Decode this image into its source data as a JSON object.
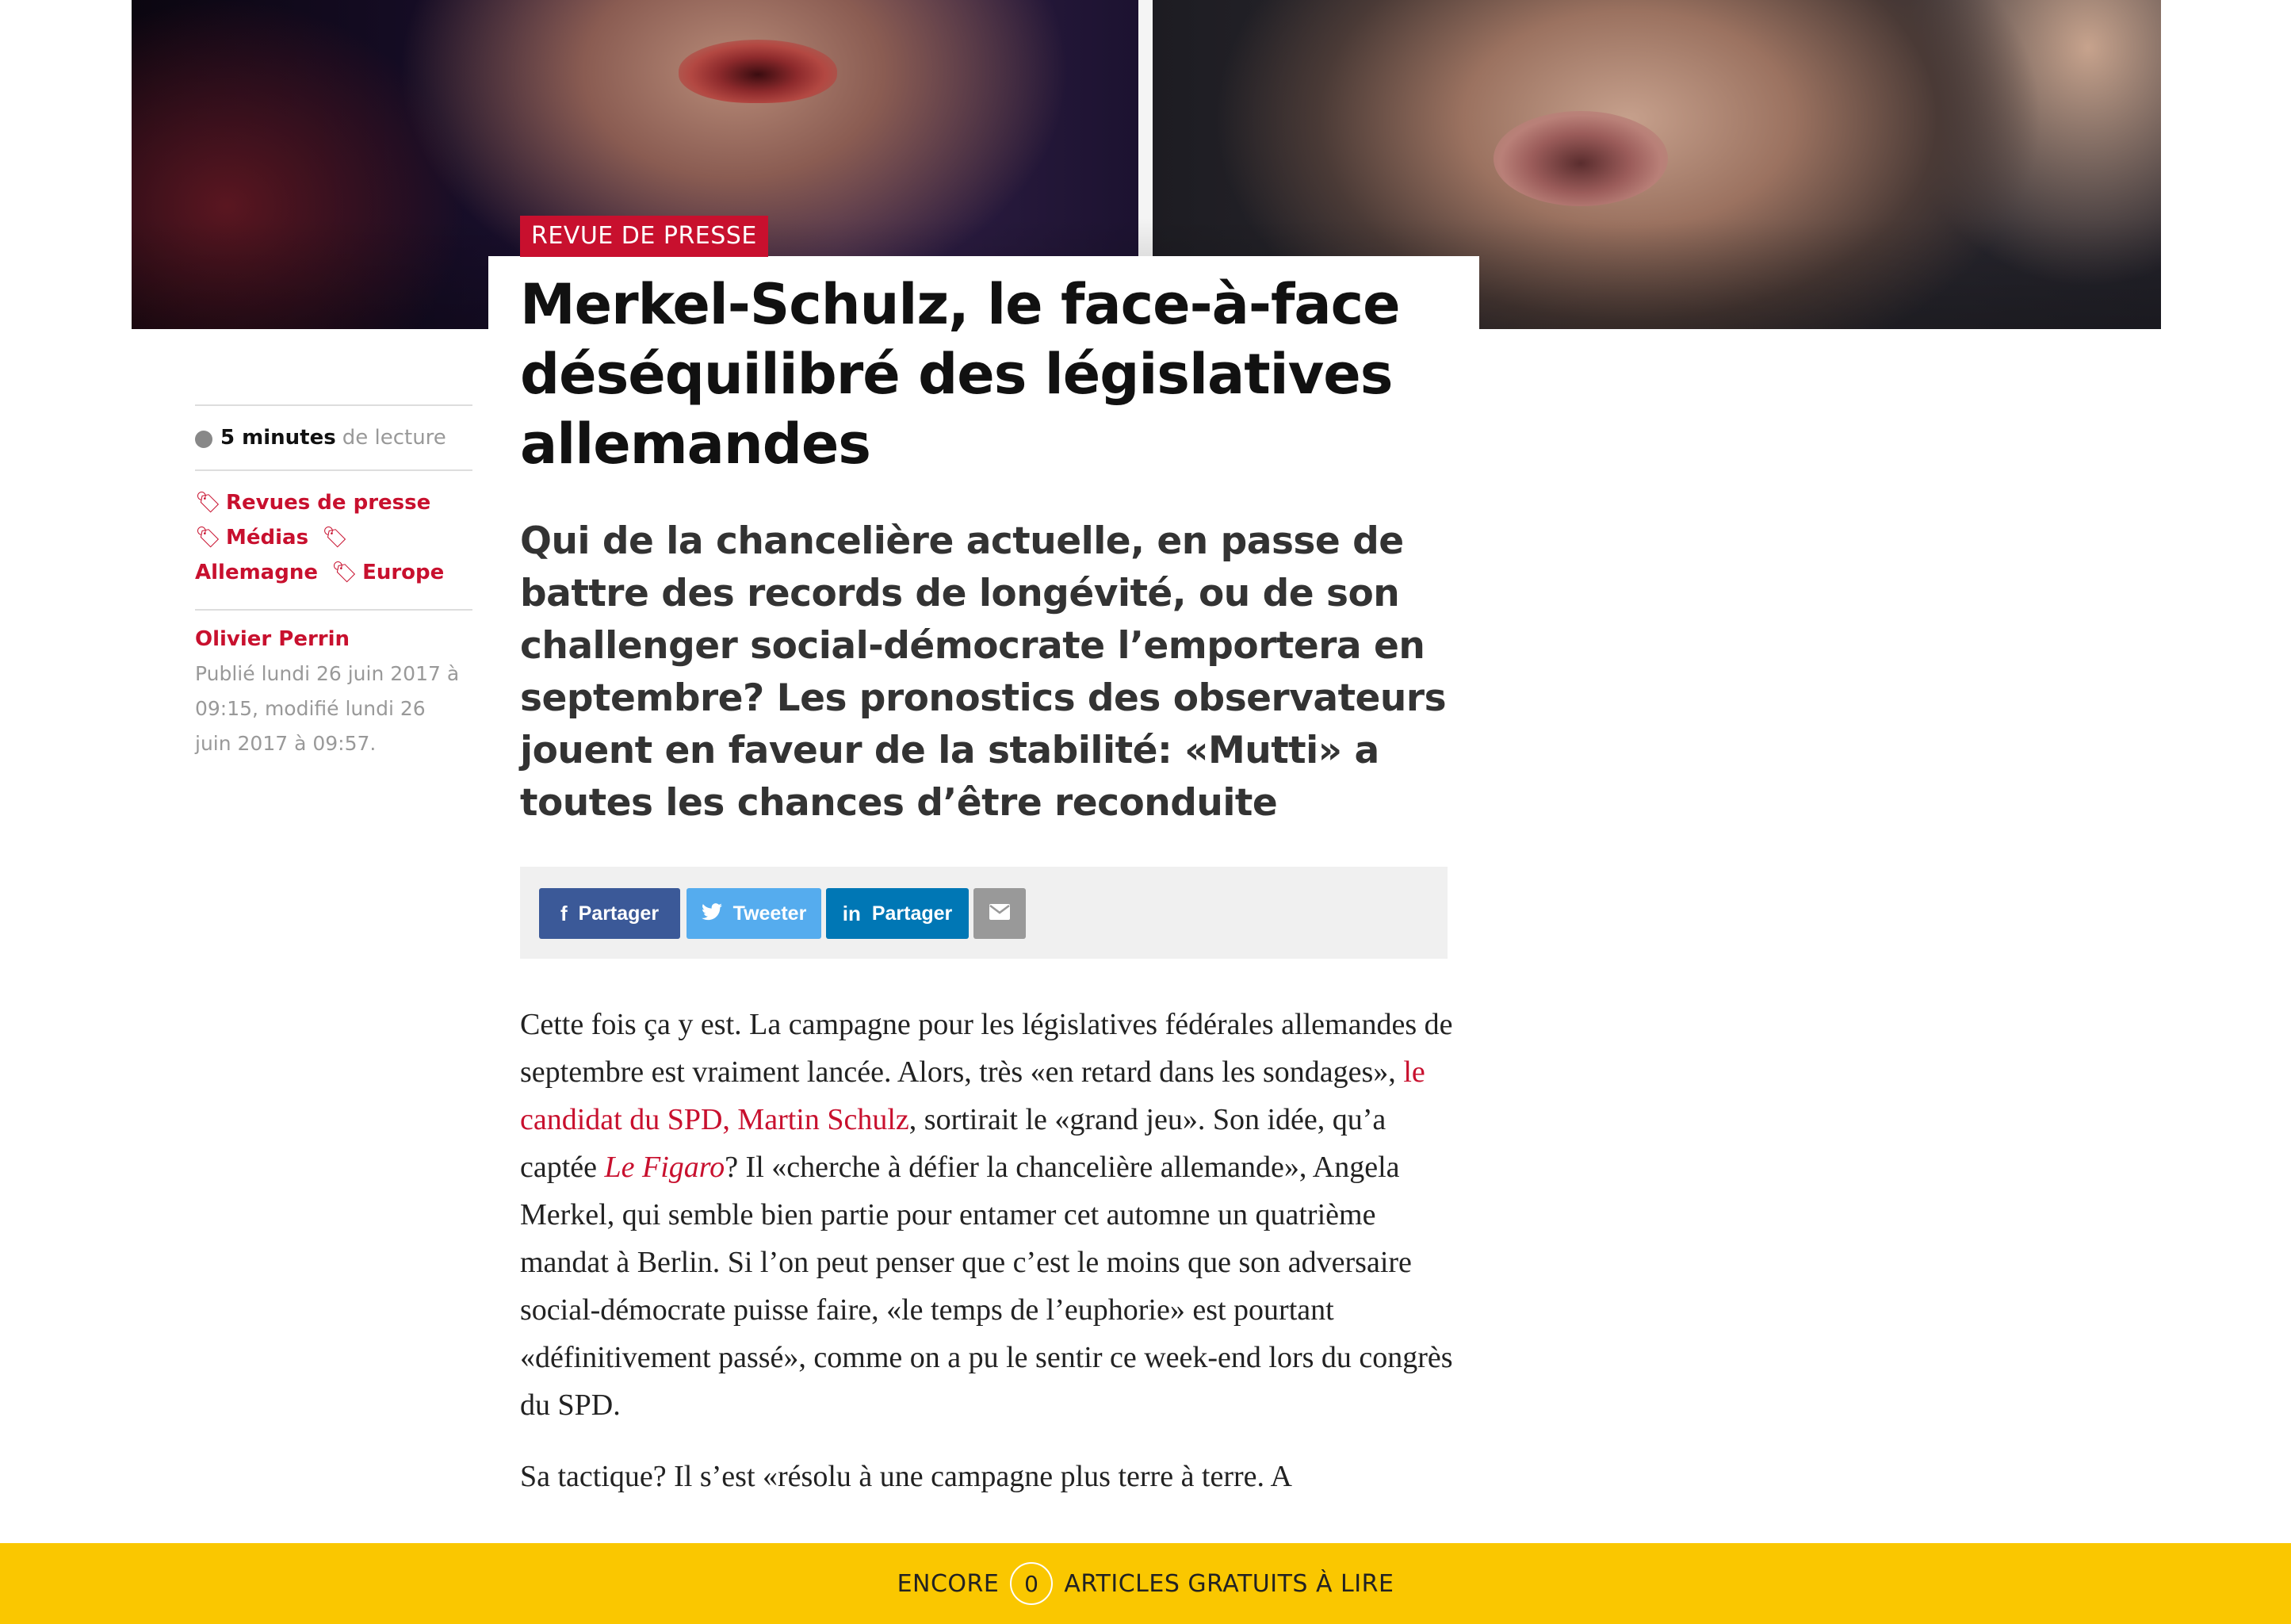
{
  "article": {
    "kicker": "REVUE DE PRESSE",
    "headline": "Merkel-Schulz, le face-à-face déséquilibré des législatives allemandes",
    "lead": "Qui de la chancelière actuelle, en passe de battre des records de longévité, ou de son challenger social-démocrate l’emportera en septembre? Les pronostics des observateurs jouent en faveur de la stabilité: «Mutti» a toutes les chances d’être reconduite"
  },
  "sidebar": {
    "reading_time_value": "5 minutes",
    "reading_time_suffix": "de lecture",
    "tags": [
      "Revues de presse",
      "Médias",
      "Allemagne",
      "Europe"
    ],
    "author": "Olivier Perrin",
    "published": "Publié lundi 26 juin 2017 à 09:15, modifié lundi 26 juin 2017 à 09:57."
  },
  "share": {
    "facebook_label": "Partager",
    "twitter_label": "Tweeter",
    "linkedin_label": "Partager",
    "facebook_icon": "facebook-icon",
    "twitter_icon": "twitter-icon",
    "linkedin_icon": "linkedin-icon",
    "mail_icon": "envelope-icon"
  },
  "body": {
    "p1_a": "Cette fois ça y est. La campagne pour les législatives fédérales allemandes de septembre est vraiment lancée. Alors, très «en retard dans les sondages», ",
    "p1_link": "le candidat du SPD, Martin Schulz",
    "p1_b": ", sortirait le «grand jeu». Son idée, qu’a captée ",
    "p1_em": "Le Figaro",
    "p1_c": "? Il «cherche à défier la chancelière allemande», Angela Merkel, qui semble bien partie pour entamer cet automne un quatrième mandat à Berlin. Si l’on peut penser que c’est le moins que son adversaire social-démocrate puisse faire, «le temps de l’euphorie» est pourtant «définitivement passé», comme on a pu le sentir ce week-end lors du congrès du SPD.",
    "p2": "Sa tactique? Il s’est «résolu à une campagne plus terre à terre. A"
  },
  "banner": {
    "prefix": "ENCORE",
    "count": "0",
    "suffix": "ARTICLES GRATUITS À LIRE"
  },
  "colors": {
    "accent": "#c8102e",
    "banner": "#fac700",
    "facebook": "#3b5998",
    "twitter": "#55acee",
    "linkedin": "#0077b5"
  }
}
